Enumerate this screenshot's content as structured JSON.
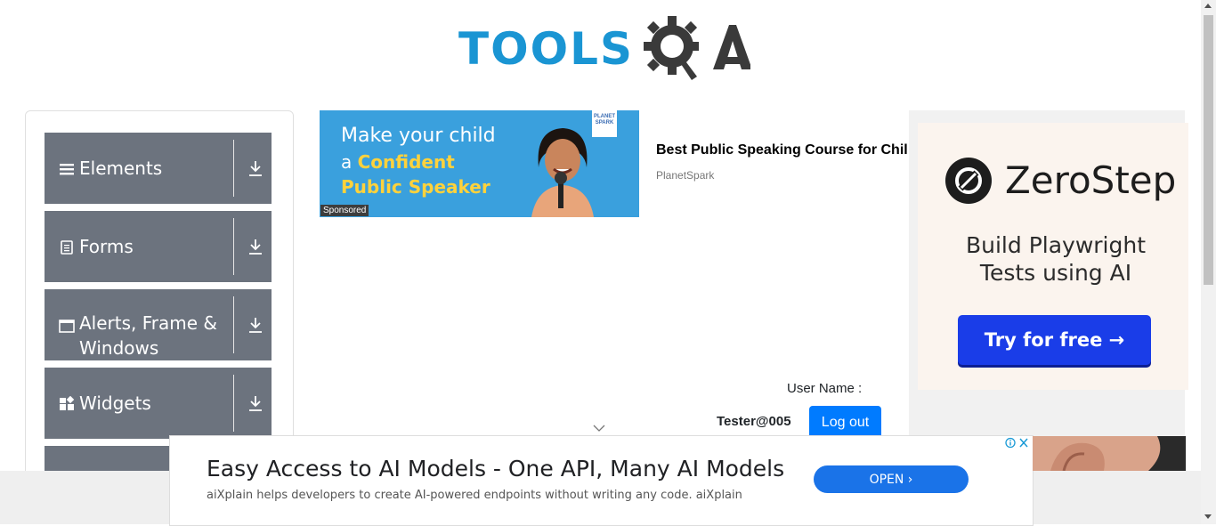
{
  "header": {
    "logo_text": "TOOLS",
    "logo_accent": "QA"
  },
  "sidebar": {
    "groups": [
      {
        "label": "Elements",
        "icon": "hamburger-icon"
      },
      {
        "label": "Forms",
        "icon": "document-icon"
      },
      {
        "label": "Alerts, Frame & Windows",
        "icon": "window-icon"
      },
      {
        "label": "Widgets",
        "icon": "widgets-icon"
      }
    ]
  },
  "sponsored": {
    "image_line1": "Make your child",
    "image_line2_a": "a ",
    "image_line2_b": "Confident",
    "image_line3": "Public Speaker",
    "badge": "Sponsored",
    "brand_mark": "PLANET SPARK",
    "title": "Best Public Speaking Course for Children",
    "source": "PlanetSpark"
  },
  "user": {
    "label": "User Name :",
    "value": "Tester@005",
    "logout": "Log out"
  },
  "right_ad": {
    "brand": "ZeroStep",
    "tagline": "Build Playwright Tests using AI",
    "button": "Try for free →"
  },
  "bottom_ad": {
    "headline": "Easy Access to AI Models - One API, Many AI Models",
    "description": "aiXplain helps developers to create AI-powered endpoints without writing any code. aiXplain",
    "button": "OPEN  ›"
  },
  "colors": {
    "primary": "#007bff",
    "sidebar": "#6c737e",
    "logo_blue": "#1a95d3",
    "zerostep_blue": "#1a3de8"
  }
}
